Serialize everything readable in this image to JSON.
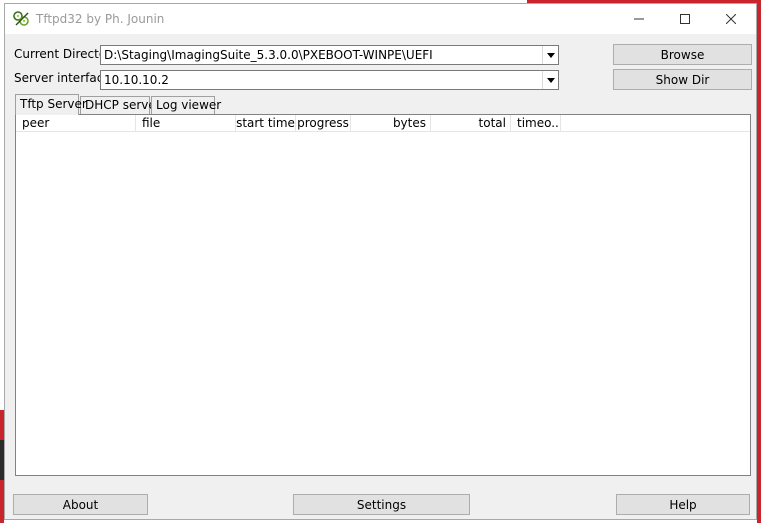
{
  "window": {
    "title": "Tftpd32 by Ph. Jounin"
  },
  "form": {
    "current_directory_label": "Current Directory",
    "current_directory_value": "D:\\Staging\\ImagingSuite_5.3.0.0\\PXEBOOT-WINPE\\UEFI",
    "server_interface_label": "Server interface",
    "server_interface_value": "10.10.10.2"
  },
  "buttons": {
    "browse": "Browse",
    "show_dir": "Show Dir",
    "about": "About",
    "settings": "Settings",
    "help": "Help"
  },
  "tabs": [
    {
      "label": "Tftp Server",
      "active": true
    },
    {
      "label": "DHCP server",
      "active": false
    },
    {
      "label": "Log viewer",
      "active": false
    }
  ],
  "table": {
    "columns": [
      "peer",
      "file",
      "start time",
      "progress",
      "bytes",
      "total",
      "timeo..."
    ],
    "rows": []
  },
  "colors": {
    "background_accent": "#c9252c",
    "window_face": "#f0f0f0"
  }
}
